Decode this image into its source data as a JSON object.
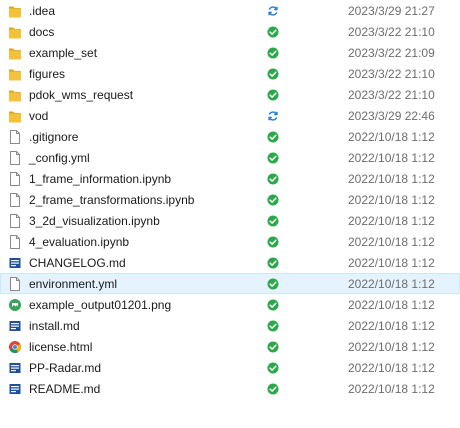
{
  "files": [
    {
      "name": ".idea",
      "type": "folder",
      "status": "sync",
      "date": "2023/3/29 21:27"
    },
    {
      "name": "docs",
      "type": "folder",
      "status": "ok",
      "date": "2023/3/22 21:10"
    },
    {
      "name": "example_set",
      "type": "folder",
      "status": "ok",
      "date": "2023/3/22 21:09"
    },
    {
      "name": "figures",
      "type": "folder",
      "status": "ok",
      "date": "2023/3/22 21:10"
    },
    {
      "name": "pdok_wms_request",
      "type": "folder",
      "status": "ok",
      "date": "2023/3/22 21:10"
    },
    {
      "name": "vod",
      "type": "folder",
      "status": "sync",
      "date": "2023/3/29 22:46"
    },
    {
      "name": ".gitignore",
      "type": "file",
      "status": "ok",
      "date": "2022/10/18 1:12"
    },
    {
      "name": "_config.yml",
      "type": "file",
      "status": "ok",
      "date": "2022/10/18 1:12"
    },
    {
      "name": "1_frame_information.ipynb",
      "type": "file",
      "status": "ok",
      "date": "2022/10/18 1:12"
    },
    {
      "name": "2_frame_transformations.ipynb",
      "type": "file",
      "status": "ok",
      "date": "2022/10/18 1:12"
    },
    {
      "name": "3_2d_visualization.ipynb",
      "type": "file",
      "status": "ok",
      "date": "2022/10/18 1:12"
    },
    {
      "name": "4_evaluation.ipynb",
      "type": "file",
      "status": "ok",
      "date": "2022/10/18 1:12"
    },
    {
      "name": "CHANGELOG.md",
      "type": "md",
      "status": "ok",
      "date": "2022/10/18 1:12"
    },
    {
      "name": "environment.yml",
      "type": "file",
      "status": "ok",
      "date": "2022/10/18 1:12",
      "selected": true
    },
    {
      "name": "example_output01201.png",
      "type": "png",
      "status": "ok",
      "date": "2022/10/18 1:12"
    },
    {
      "name": "install.md",
      "type": "md",
      "status": "ok",
      "date": "2022/10/18 1:12"
    },
    {
      "name": "license.html",
      "type": "html",
      "status": "ok",
      "date": "2022/10/18 1:12"
    },
    {
      "name": "PP-Radar.md",
      "type": "md",
      "status": "ok",
      "date": "2022/10/18 1:12"
    },
    {
      "name": "README.md",
      "type": "md",
      "status": "ok",
      "date": "2022/10/18 1:12"
    }
  ],
  "colors": {
    "folder": "#f3c13a",
    "folder_dark": "#dba520",
    "status_ok": "#2ba84a",
    "status_sync": "#1e7bd6",
    "selected_bg": "#e5f3ff",
    "md_icon": "#1f4e9c"
  },
  "icons": {
    "folder": "folder-icon",
    "file": "file-icon",
    "md": "markdown-file-icon",
    "png": "image-file-icon",
    "html": "chrome-icon",
    "ok": "synced-check-icon",
    "sync": "sync-pending-icon"
  }
}
